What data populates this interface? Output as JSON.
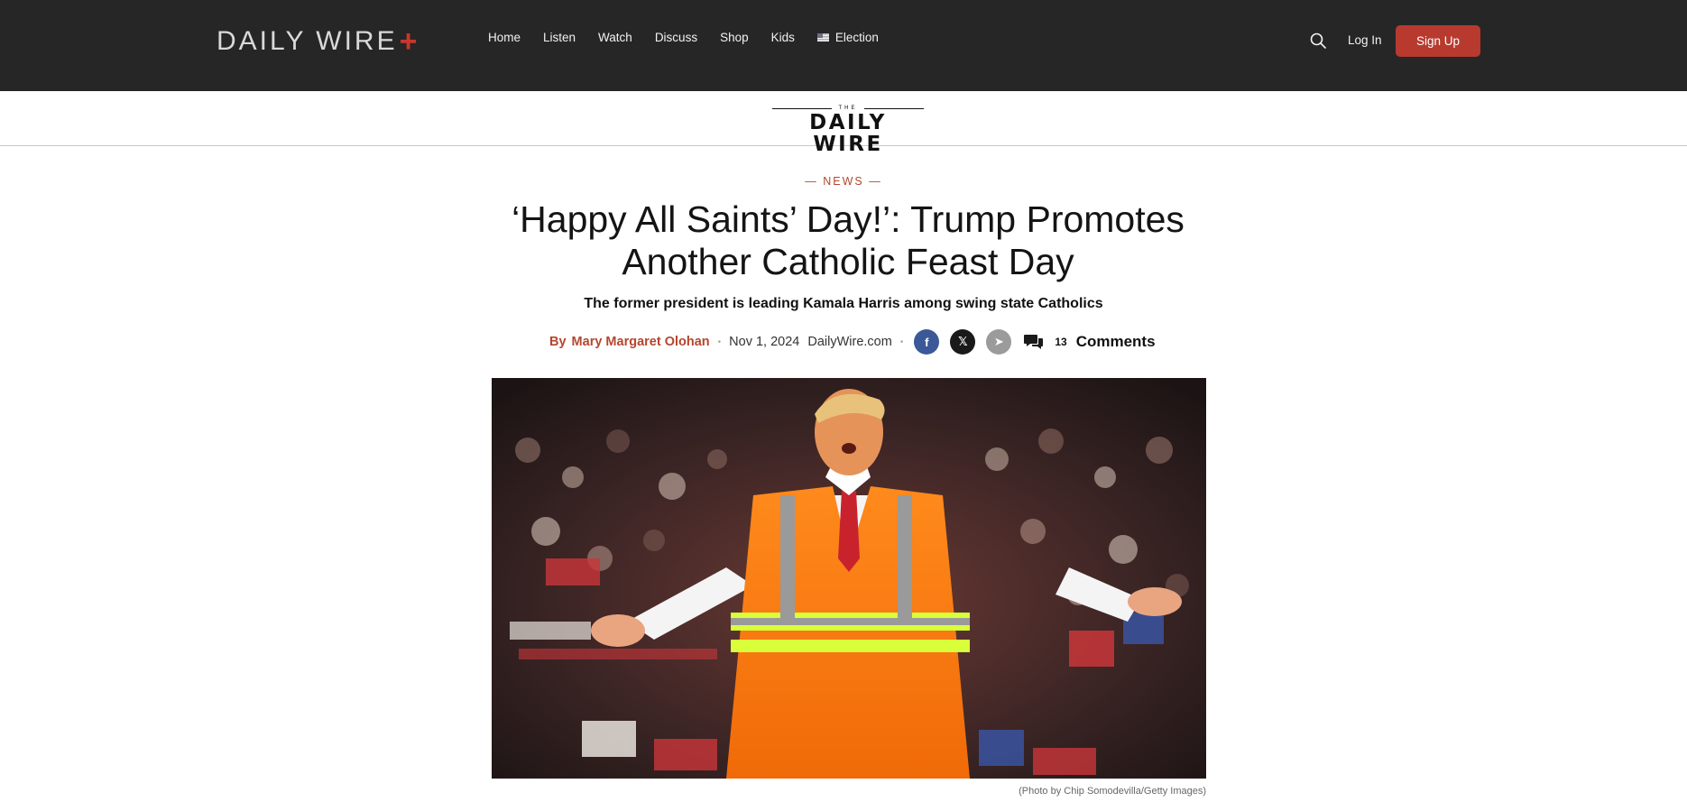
{
  "nav": {
    "logo": "DAILY WIRE",
    "logo_plus": "+",
    "items": [
      {
        "label": "Home"
      },
      {
        "label": "Listen"
      },
      {
        "label": "Watch"
      },
      {
        "label": "Discuss"
      },
      {
        "label": "Shop"
      },
      {
        "label": "Kids"
      },
      {
        "label": "Election",
        "icon": "us-flag-icon"
      }
    ],
    "search_icon": "search-icon",
    "login_label": "Log In",
    "signup_label": "Sign Up",
    "colors": {
      "bar": "#262626",
      "accent": "#b83a2e"
    }
  },
  "masthead": {
    "the": "THE",
    "name": "DAILY WIRE"
  },
  "article": {
    "section": "— NEWS —",
    "headline": "‘Happy All Saints’ Day!’: Trump Promotes Another Catholic Feast Day",
    "subhead": "The former president is leading Kamala Harris among swing state Catholics",
    "byline": {
      "by": "By",
      "author": "Mary Margaret Olohan",
      "date": "Nov 1, 2024",
      "source": "DailyWire.com",
      "share": [
        {
          "network": "facebook",
          "icon": "facebook-icon",
          "glyph": "f"
        },
        {
          "network": "x",
          "icon": "x-icon",
          "glyph": "𝕏"
        },
        {
          "network": "telegram",
          "icon": "telegram-icon",
          "glyph": "➤"
        }
      ],
      "comment_icon": "comment-icon",
      "comment_count": "13",
      "comment_label": "Comments"
    },
    "hero_caption": "(Photo by Chip Somodevilla/Getty Images)"
  }
}
